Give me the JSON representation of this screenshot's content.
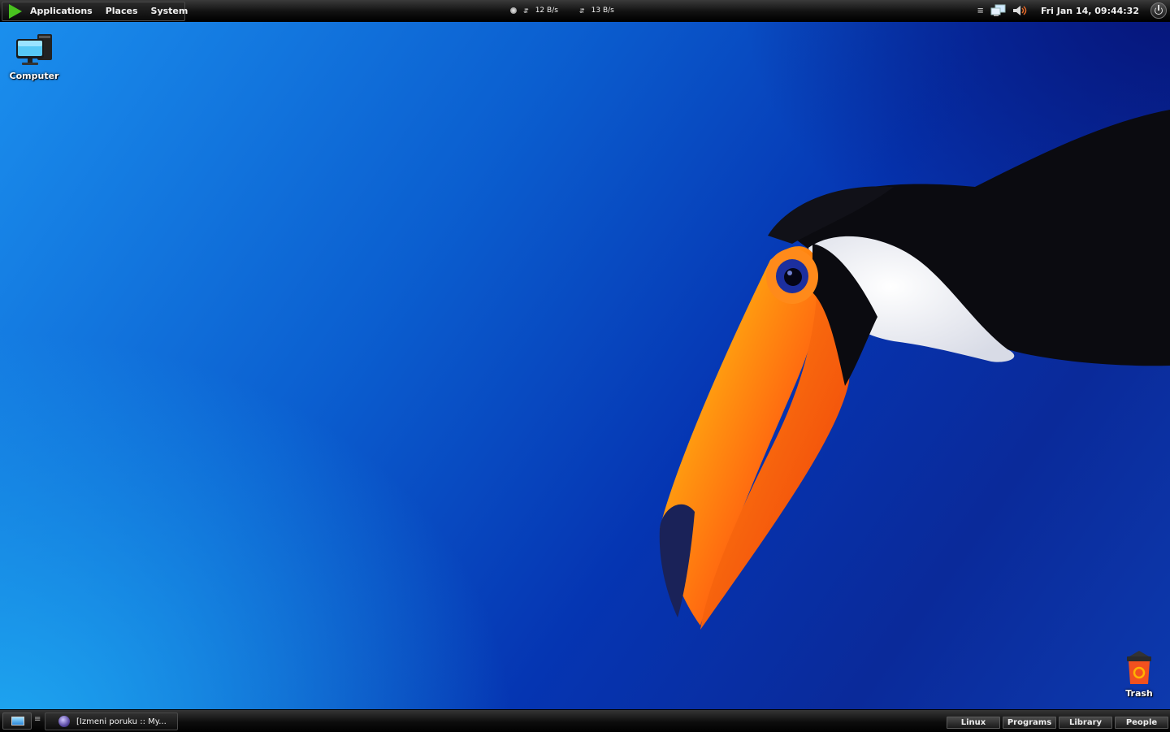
{
  "top_panel": {
    "menus": [
      "Applications",
      "Places",
      "System"
    ],
    "net_down": "12 B/s",
    "net_up": "13 B/s",
    "clock": "Fri Jan 14, 09:44:32"
  },
  "desktop_icons": {
    "computer": "Computer",
    "trash": "Trash"
  },
  "bottom_panel": {
    "task_title": "[Izmeni poruku :: My...",
    "workspaces": [
      "Linux",
      "Programs",
      "Library",
      "People"
    ]
  },
  "colors": {
    "start_green": "#49c21f",
    "wallpaper_dark": "#06157a",
    "wallpaper_light": "#1ea6f0"
  }
}
